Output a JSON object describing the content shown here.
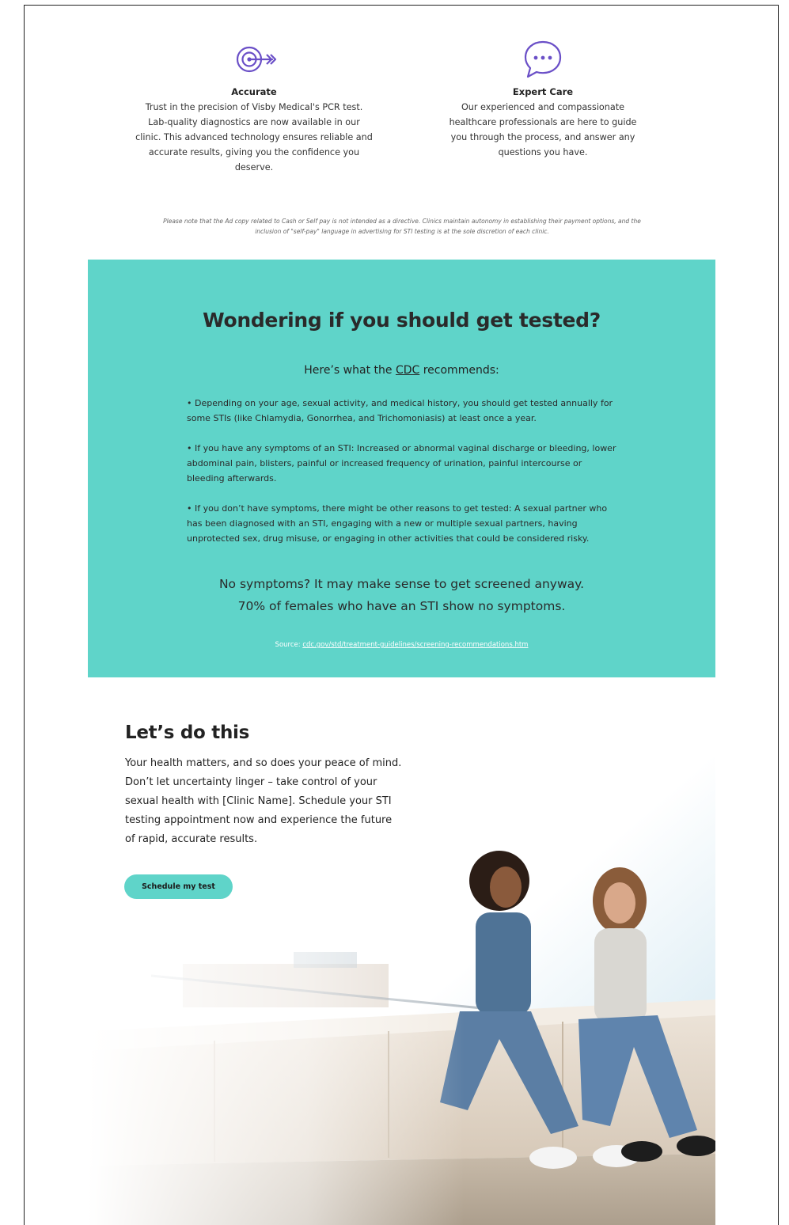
{
  "features": [
    {
      "icon": "target-arrow-icon",
      "title": "Accurate",
      "text": "Trust in the precision of Visby Medical's PCR test. Lab-quality diagnostics are now available in our clinic. This advanced technology ensures reliable and accurate results, giving you the confidence you deserve."
    },
    {
      "icon": "chat-bubble-icon",
      "title": "Expert Care",
      "text": "Our experienced and compassionate healthcare professionals are here to guide you through the process, and answer any questions you have."
    }
  ],
  "disclaimer": "Please note that the Ad copy related to Cash or Self pay is not intended as a directive. Clinics maintain autonomy in establishing their payment options, and the inclusion of \"self-pay\" language in advertising for STI testing is at the sole discretion of each clinic.",
  "testing": {
    "heading": "Wondering if you should get tested?",
    "sub_prefix": "Here’s what the ",
    "sub_link": "CDC",
    "sub_suffix": " recommends:",
    "bullets": [
      "• Depending on your age, sexual activity, and medical history, you should get tested annually for some STIs (like Chlamydia, Gonorrhea, and Trichomoniasis) at least once a year.",
      "• If you have any symptoms of an STI: Increased or abnormal vaginal discharge or bleeding, lower abdominal pain, blisters, painful or increased frequency of urination, painful intercourse or bleeding afterwards.",
      "• If you don’t have symptoms, there might be other reasons to get tested: A sexual partner who has been diagnosed with an STI, engaging with a new or multiple sexual partners, having unprotected sex, drug misuse, or engaging in other activities that could be considered risky."
    ],
    "cta_line1": "No symptoms? It may make sense to get screened anyway.",
    "cta_line2": "70% of females who have an STI show no symptoms.",
    "source_label": "Source: ",
    "source_link": "cdc.gov/std/treatment-guidelines/screening-recommendations.htm"
  },
  "hero": {
    "heading": "Let’s do this",
    "text": "Your health matters, and so does your peace of mind. Don’t let uncertainty linger – take control of your sexual health with [Clinic Name]. Schedule your STI testing appointment now and experience the future of rapid, accurate results.",
    "button": "Schedule my test",
    "photo": "two-women-sitting-on-ledge-photo"
  },
  "colors": {
    "teal": "#5fd4c9",
    "icon_purple": "#6a4fc7",
    "text_dark": "#222222"
  }
}
